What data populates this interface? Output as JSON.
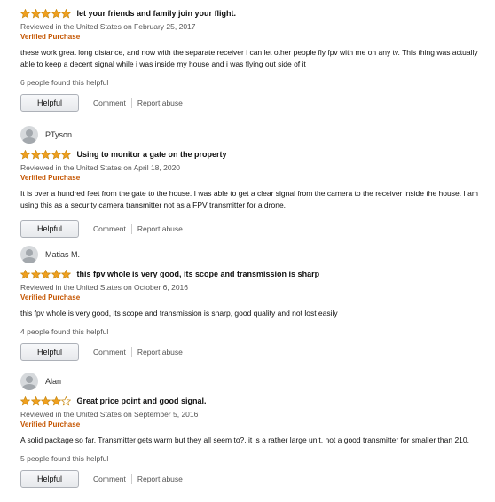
{
  "labels": {
    "verified": "Verified Purchase",
    "helpful": "Helpful",
    "comment": "Comment",
    "report": "Report abuse"
  },
  "colors": {
    "star": "#f0a020",
    "star_outline": "#c98a12",
    "verified": "#c45500"
  },
  "reviews": [
    {
      "rating": 5,
      "title": "let your friends and family join your flight.",
      "date": "Reviewed in the United States on February 25, 2017",
      "body": "these work great long distance, and now with the separate receiver i can let other people fly fpv with me on any tv. This thing was actually able to keep a decent signal while i was inside my house and i was flying out side of it",
      "helpful_count": "6 people found this helpful"
    },
    {
      "author": "PTyson",
      "rating": 5,
      "title": "Using to monitor a gate on the property",
      "date": "Reviewed in the United States on April 18, 2020",
      "body": "It is over a hundred feet from the gate to the house. I was able to get a clear signal from the camera to the receiver inside the house. I am using this as a security camera transmitter not as a FPV transmitter for a drone."
    },
    {
      "author": "Matias M.",
      "rating": 5,
      "title": "this fpv whole is very good, its scope and transmission is sharp",
      "date": "Reviewed in the United States on October 6, 2016",
      "body": "this fpv whole is very good, its scope and transmission is sharp, good quality and not lost easily",
      "helpful_count": "4 people found this helpful"
    },
    {
      "author": "Alan",
      "rating": 4,
      "title": "Great price point and good signal.",
      "date": "Reviewed in the United States on September 5, 2016",
      "body": "A solid package so far. Transmitter gets warm but they all seem to?, it is a rather large unit, not a good transmitter for smaller than 210.",
      "helpful_count": "5 people found this helpful"
    }
  ]
}
